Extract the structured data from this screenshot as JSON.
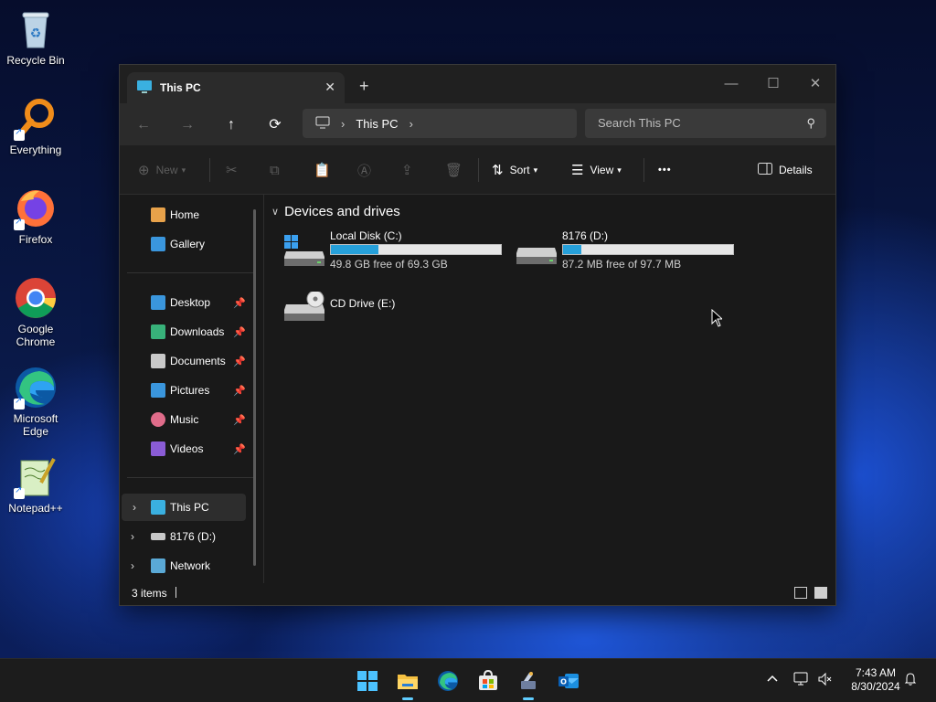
{
  "desktop": {
    "icons": [
      {
        "label": "Recycle Bin",
        "icon": "recycle-bin-icon"
      },
      {
        "label": "Everything",
        "icon": "everything-search-icon"
      },
      {
        "label": "Firefox",
        "icon": "firefox-icon"
      },
      {
        "label": "Google Chrome",
        "icon": "chrome-icon"
      },
      {
        "label": "Microsoft Edge",
        "icon": "edge-icon"
      },
      {
        "label": "Notepad++",
        "icon": "notepadpp-icon"
      }
    ]
  },
  "explorer": {
    "tab": {
      "title": "This PC",
      "close": "✕",
      "new_tab": "+"
    },
    "window_controls": {
      "minimize": "—",
      "maximize": "☐",
      "close": "✕"
    },
    "nav": {
      "back": "←",
      "forward": "→",
      "up": "↑",
      "refresh": "⟳"
    },
    "address": {
      "crumbs": [
        "This PC"
      ],
      "separator": "›"
    },
    "search": {
      "placeholder": "Search This PC"
    },
    "commands": {
      "new": "New",
      "sort": "Sort",
      "view": "View",
      "more": "•••",
      "details": "Details"
    },
    "sidebar": {
      "top": [
        {
          "label": "Home",
          "icon": "home-icon",
          "color": "#e8a24a"
        },
        {
          "label": "Gallery",
          "icon": "gallery-icon",
          "color": "#3a96dd"
        }
      ],
      "quick": [
        {
          "label": "Desktop",
          "icon": "desktop-folder-icon",
          "color": "#3a96dd"
        },
        {
          "label": "Downloads",
          "icon": "downloads-icon",
          "color": "#38b27a"
        },
        {
          "label": "Documents",
          "icon": "documents-icon",
          "color": "#c9c9c9"
        },
        {
          "label": "Pictures",
          "icon": "pictures-icon",
          "color": "#3a96dd"
        },
        {
          "label": "Music",
          "icon": "music-icon",
          "color": "#e06c8a"
        },
        {
          "label": "Videos",
          "icon": "videos-icon",
          "color": "#8a5cd6"
        }
      ],
      "drives": [
        {
          "label": "This PC",
          "icon": "this-pc-icon",
          "color": "#3ab0e0",
          "selected": true
        },
        {
          "label": "8176 (D:)",
          "icon": "drive-icon",
          "color": "#c8c8c8",
          "selected": false
        },
        {
          "label": "Network",
          "icon": "network-icon",
          "color": "#5aa9d6",
          "selected": false
        }
      ]
    },
    "section": {
      "title": "Devices and drives"
    },
    "drives": [
      {
        "name": "Local Disk (C:)",
        "free": "49.8 GB free of 69.3 GB",
        "used_fraction": 0.28,
        "icon": "windows-drive-icon"
      },
      {
        "name": "8176 (D:)",
        "free": "87.2 MB free of 97.7 MB",
        "used_fraction": 0.11,
        "icon": "drive-icon"
      },
      {
        "name": "CD Drive (E:)",
        "free": "",
        "used_fraction": null,
        "icon": "cd-drive-icon"
      }
    ],
    "status": {
      "items": "3 items"
    }
  },
  "taskbar": {
    "apps": [
      "start-icon",
      "file-explorer-icon",
      "edge-icon",
      "store-icon",
      "tool-icon",
      "outlook-icon"
    ],
    "clock": {
      "time": "7:43 AM",
      "date": "8/30/2024"
    },
    "tray": {
      "chevron": "^"
    }
  },
  "colors": {
    "accent": "#26a0da",
    "window_bg": "#191919",
    "toolbar_bg": "#2b2b2b"
  }
}
